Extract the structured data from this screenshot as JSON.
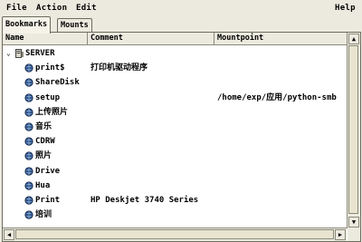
{
  "menubar": {
    "file": "File",
    "action": "Action",
    "edit": "Edit",
    "help": "Help"
  },
  "tabs": {
    "bookmarks": "Bookmarks",
    "mounts": "Mounts"
  },
  "columns": {
    "name": "Name",
    "comment": "Comment",
    "mountpoint": "Mountpoint"
  },
  "server": {
    "expander": "⌄",
    "name": "SERVER"
  },
  "shares": [
    {
      "name": "print$",
      "comment": "打印机驱动程序",
      "mountpoint": ""
    },
    {
      "name": "ShareDisk",
      "comment": "",
      "mountpoint": ""
    },
    {
      "name": "setup",
      "comment": "",
      "mountpoint": "/home/exp/应用/python-smb"
    },
    {
      "name": "上传照片",
      "comment": "",
      "mountpoint": ""
    },
    {
      "name": "音乐",
      "comment": "",
      "mountpoint": ""
    },
    {
      "name": "CDRW",
      "comment": "",
      "mountpoint": ""
    },
    {
      "name": "照片",
      "comment": "",
      "mountpoint": ""
    },
    {
      "name": "Drive",
      "comment": "",
      "mountpoint": ""
    },
    {
      "name": "Hua",
      "comment": "",
      "mountpoint": ""
    },
    {
      "name": "Print",
      "comment": "HP Deskjet 3740 Series",
      "mountpoint": ""
    },
    {
      "name": "培训",
      "comment": "",
      "mountpoint": ""
    }
  ],
  "icons": {
    "server": "server-computer-icon",
    "share": "network-share-icon"
  }
}
